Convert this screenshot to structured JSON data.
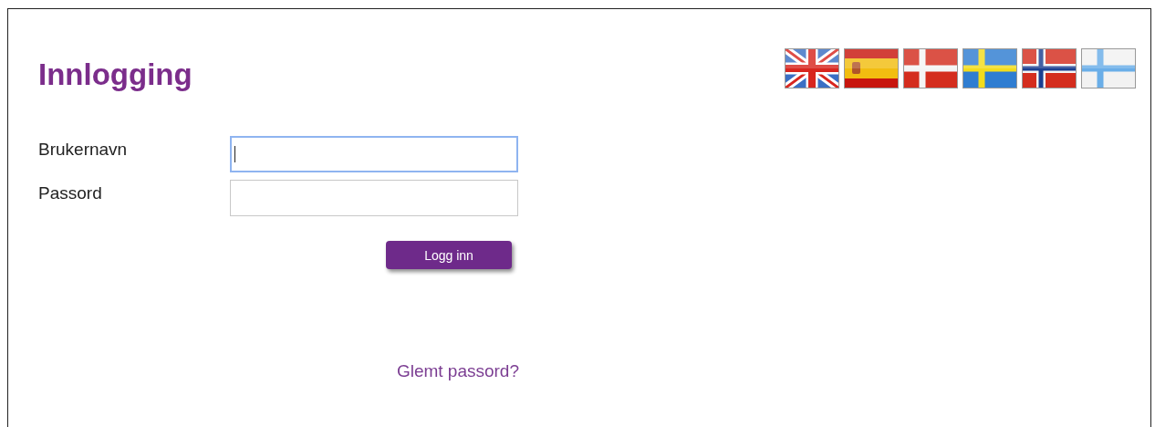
{
  "title": "Innlogging",
  "languages": [
    {
      "kind": "uk"
    },
    {
      "kind": "es"
    },
    {
      "kind": "dk"
    },
    {
      "kind": "se"
    },
    {
      "kind": "no"
    },
    {
      "kind": "fi"
    }
  ],
  "fields": [
    {
      "label": "Brukernavn",
      "focused": true
    },
    {
      "label": "Passord",
      "focused": false
    }
  ],
  "submit": "Logg inn",
  "forgot_link": "Glemt passord?"
}
